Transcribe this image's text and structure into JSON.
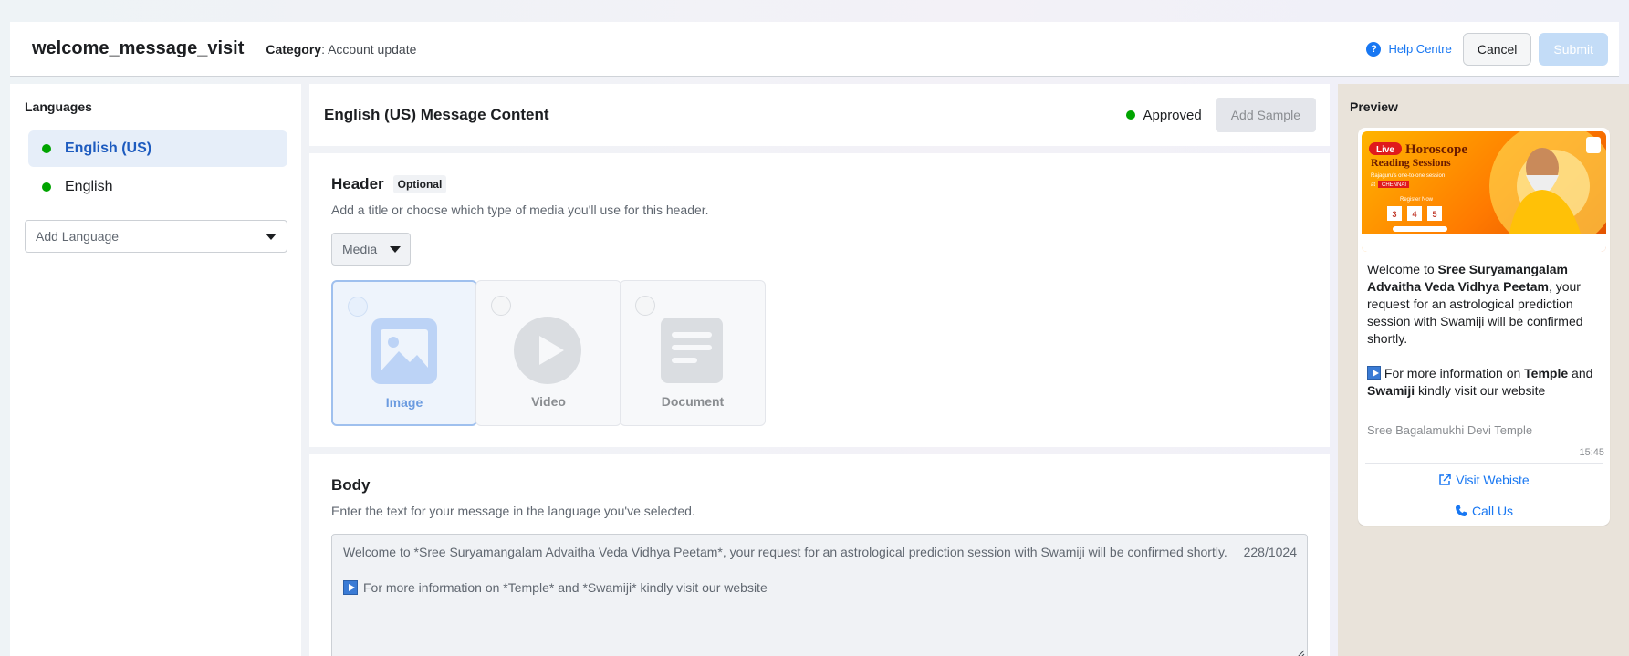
{
  "header": {
    "template_name": "welcome_message_visit",
    "category_label": "Category",
    "category_value": ": Account update",
    "help_label": "Help Centre",
    "cancel_label": "Cancel",
    "submit_label": "Submit"
  },
  "languages": {
    "title": "Languages",
    "items": [
      {
        "label": "English (US)",
        "active": true
      },
      {
        "label": "English",
        "active": false
      }
    ],
    "add_placeholder": "Add Language"
  },
  "content": {
    "title": "English (US) Message Content",
    "status": "Approved",
    "add_sample_label": "Add Sample"
  },
  "header_section": {
    "title": "Header",
    "optional_badge": "Optional",
    "subtitle": "Add a title or choose which type of media you'll use for this header.",
    "media_dropdown": "Media",
    "media_options": [
      {
        "label": "Image",
        "icon": "image-icon",
        "selected": true
      },
      {
        "label": "Video",
        "icon": "play-icon",
        "selected": false
      },
      {
        "label": "Document",
        "icon": "document-icon",
        "selected": false
      }
    ]
  },
  "body_section": {
    "title": "Body",
    "subtitle": "Enter the text for your message in the language you've selected.",
    "line1": "Welcome to *Sree Suryamangalam Advaitha Veda Vidhya Peetam*, your request for an astrological prediction session with Swamiji will be confirmed shortly.",
    "line2": "For more information on *Temple* and *Swamiji* kindly visit our website",
    "counter": "228/1024"
  },
  "preview": {
    "title": "Preview",
    "image_texts": {
      "live": "Live",
      "headline1": "Horoscope",
      "headline2": "Reading Sessions",
      "tagline": "Rajaguru's one-to-one session",
      "at": "at",
      "city": "CHENNAI",
      "register": "Register Now",
      "dates": [
        "3",
        "4",
        "5"
      ]
    },
    "text_welcome": "Welcome to ",
    "text_org": "Sree Suryamangalam Advaitha Veda Vidhya Peetam",
    "text_rest": ", your request for an astrological prediction session with Swamiji will be confirmed shortly.",
    "text_info_pre": " For more information on ",
    "text_temple": "Temple",
    "text_and": " and ",
    "text_swamiji": "Swamiji",
    "text_info_post": " kindly visit our website",
    "footer": "Sree Bagalamukhi Devi Temple",
    "time": "15:45",
    "button_website": "Visit Webiste",
    "button_call": "Call Us"
  },
  "colors": {
    "primary": "#1877f2",
    "approved": "#00a400",
    "submit_disabled": "#c3dcf7"
  }
}
